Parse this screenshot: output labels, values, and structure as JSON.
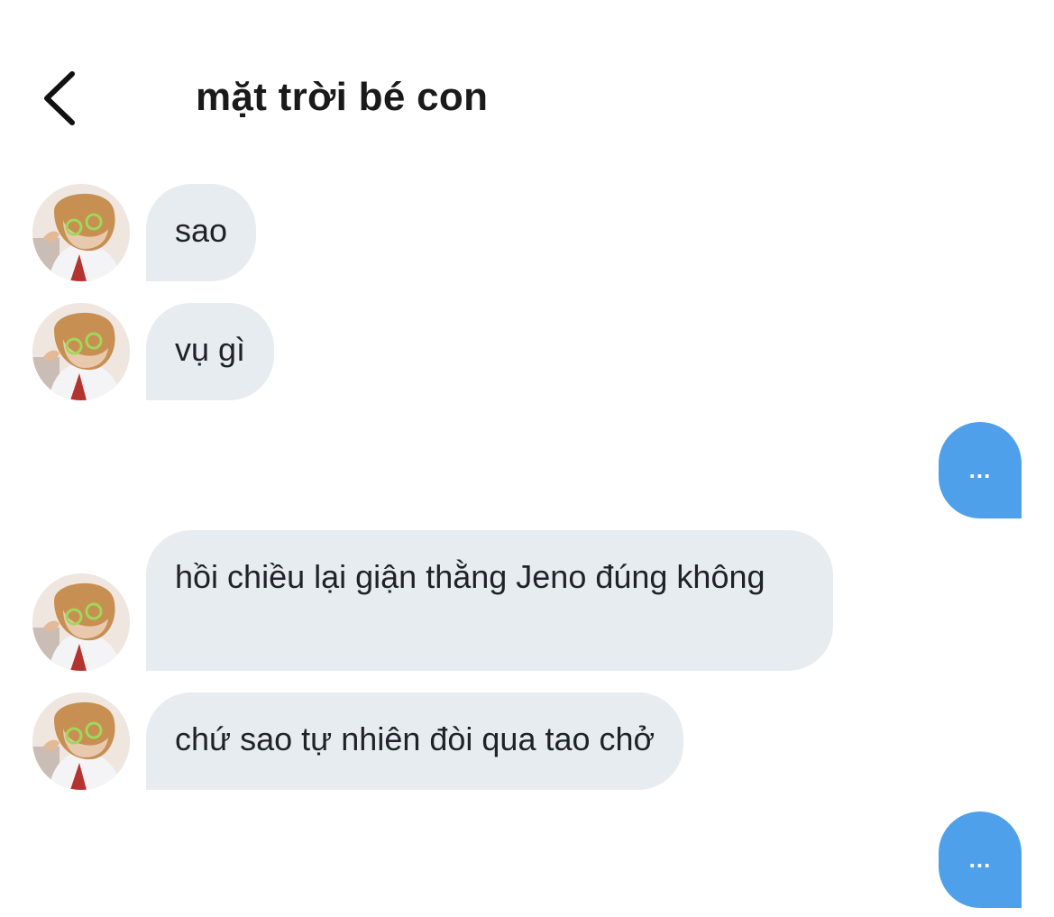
{
  "header": {
    "title": "mặt trời bé con",
    "back_icon": "chevron-left-icon"
  },
  "messages": [
    {
      "direction": "incoming",
      "text": "sao"
    },
    {
      "direction": "incoming",
      "text": "vụ gì"
    },
    {
      "direction": "outgoing",
      "text": "..."
    },
    {
      "direction": "incoming",
      "text": "hồi chiều lại giận thằng Jeno đúng không"
    },
    {
      "direction": "incoming",
      "text": "chứ sao tự nhiên đòi qua tao chở"
    },
    {
      "direction": "outgoing",
      "text": "..."
    }
  ],
  "colors": {
    "incoming_bubble": "#e7ecf0",
    "outgoing_bubble": "#4ea0ea",
    "text": "#1f2329"
  }
}
